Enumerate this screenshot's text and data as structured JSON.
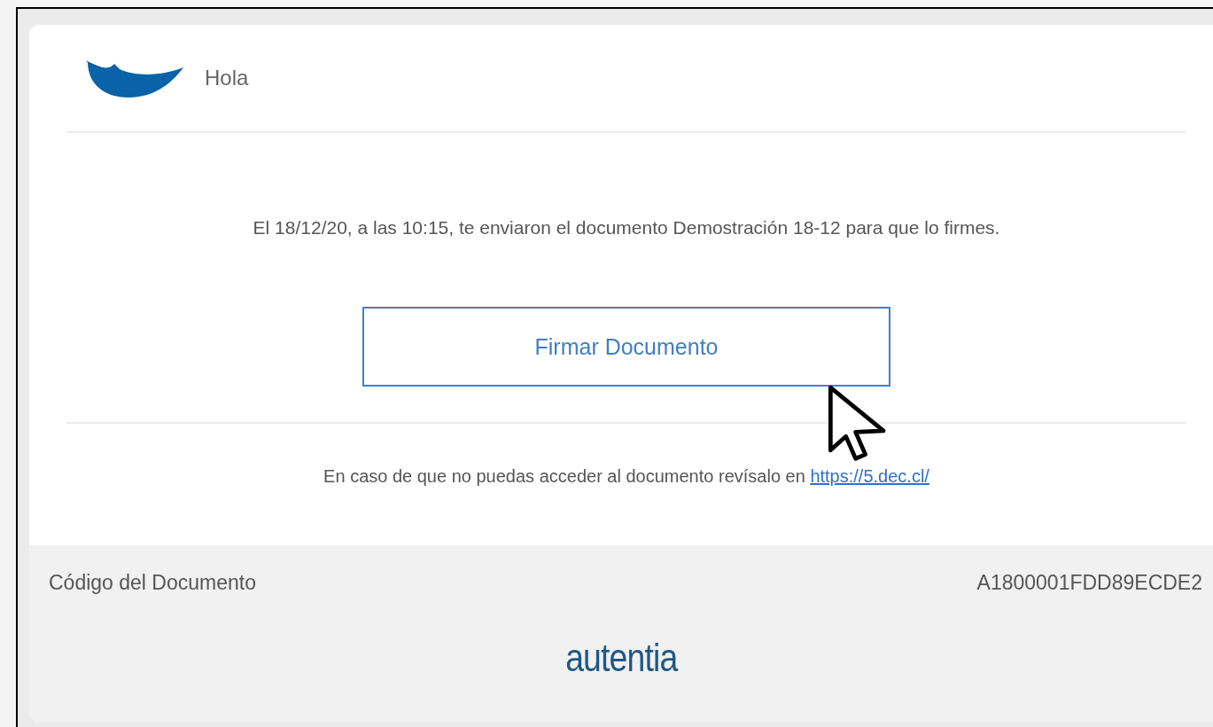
{
  "header": {
    "greeting": "Hola"
  },
  "message": "El 18/12/20, a las 10:15, te enviaron el documento Demostración 18-12 para que lo firmes.",
  "sign_button": {
    "label": "Firmar Documento"
  },
  "fallback": {
    "text": "En caso de que no puedas acceder al documento revísalo en",
    "link": "https://5.dec.cl/"
  },
  "footer": {
    "code_label": "Código del Documento",
    "code_value": "A1800001FDD89ECDE2",
    "brand": "autentia"
  }
}
